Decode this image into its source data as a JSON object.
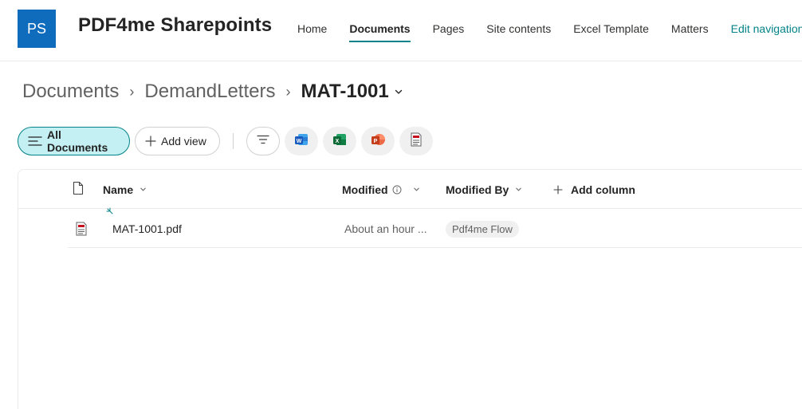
{
  "site": {
    "logo_initials": "PS",
    "title": "PDF4me Sharepoints",
    "logo_color": "#0f6cbd"
  },
  "nav": {
    "items": [
      {
        "label": "Home"
      },
      {
        "label": "Documents"
      },
      {
        "label": "Pages"
      },
      {
        "label": "Site contents"
      },
      {
        "label": "Excel Template"
      },
      {
        "label": "Matters"
      }
    ],
    "active": "Documents",
    "edit_label": "Edit navigation",
    "accent_color": "#038387"
  },
  "breadcrumb": {
    "items": [
      "Documents",
      "DemandLetters",
      "MAT-1001"
    ],
    "separator": "›"
  },
  "commandbar": {
    "all_documents_label": "All Documents",
    "add_view_label": "Add view",
    "icons": [
      "filter-icon",
      "word-icon",
      "excel-icon",
      "powerpoint-icon",
      "pdf-icon"
    ]
  },
  "list": {
    "columns": {
      "name": "Name",
      "modified": "Modified",
      "modified_by": "Modified By",
      "add_column": "Add column"
    },
    "rows": [
      {
        "name": "MAT-1001.pdf",
        "modified": "About an hour ...",
        "modified_by": "Pdf4me Flow",
        "icon": "pdf-file-icon",
        "new_indicator": "new-item-icon"
      }
    ]
  }
}
